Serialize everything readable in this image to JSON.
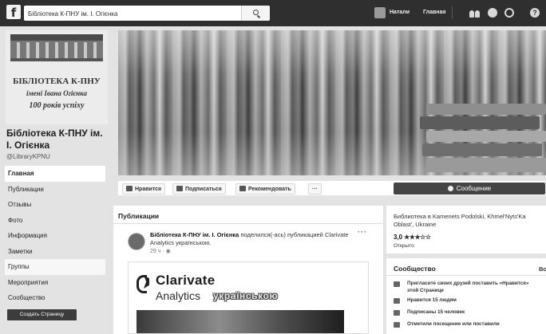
{
  "topbar": {
    "search_value": "Бібліотека К-ПНУ ім. І. Огієнка",
    "user_name": "Натали",
    "home_link": "Главная"
  },
  "profile_picture": {
    "line1": "БІБЛІОТЕКА К-ПНУ",
    "line2": "імені Івана Огієнка",
    "line3": "100 років успіху"
  },
  "page": {
    "name": "Бібліотека К-ПНУ ім. І. Огієнка",
    "handle": "@LibraryKPNU"
  },
  "sidebar": {
    "items": [
      {
        "label": "Главная"
      },
      {
        "label": "Публикации"
      },
      {
        "label": "Отзывы"
      },
      {
        "label": "Фото"
      },
      {
        "label": "Информация"
      },
      {
        "label": "Заметки"
      },
      {
        "label": "Группы"
      },
      {
        "label": "Мероприятия"
      },
      {
        "label": "Сообщество"
      }
    ],
    "create_page": "Создать Страницу"
  },
  "actions": {
    "like": "Нравится",
    "follow": "Подписаться",
    "recommend": "Рекомендовать",
    "more": "···",
    "message": "Сообщение"
  },
  "posts": {
    "title": "Публикации",
    "author": "Бібліотека К-ПНУ ім. І. Огієнка",
    "shared_text_1": "поделился(-ась)",
    "shared_text_2": "публикацией Clarivate Analytics українською.",
    "time": "29 ч · ",
    "more": "···",
    "card_brand": "Clarivate",
    "card_sub": "Analytics",
    "card_lang": "українською"
  },
  "about": {
    "location": "Библиотека в Kamenets Podolski, Khmel'Nyts'Ka Oblast', Ukraine",
    "rating": "3,0",
    "stars": "★★★☆☆",
    "status": "Открыто"
  },
  "community": {
    "title": "Сообщество",
    "extra": "Вс",
    "rows": [
      {
        "text": "Пригласите своих друзей поставить «Нравится» этой Странице"
      },
      {
        "text": "Нравится 15 людям"
      },
      {
        "text": "Подписаны 15 человек"
      },
      {
        "text": "Отметили посещение или поставили"
      }
    ]
  },
  "colors": {
    "topbar": "#2f2f2f",
    "background": "#e3e3e3",
    "message_button": "#444444"
  },
  "icons": [
    "facebook-logo-icon",
    "search-icon",
    "friends-icon",
    "messages-icon",
    "notifications-icon",
    "help-icon",
    "like-icon",
    "rss-icon",
    "recommend-icon",
    "message-icon"
  ]
}
